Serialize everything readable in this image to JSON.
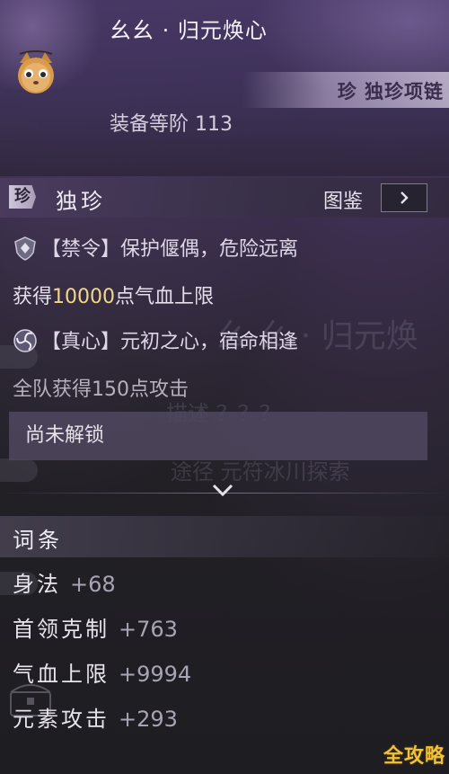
{
  "header": {
    "item_name": "幺幺 · 归元焕心",
    "item_type": "珍 独珍项链",
    "gear_level": "装备等阶 113"
  },
  "rarity_section": {
    "badge": "珍",
    "title": "独珍",
    "catalog_label": "图鉴"
  },
  "effects": {
    "forbidden_title": "【禁令】保护偃偶，危险远离",
    "forbidden_desc_prefix": "获得",
    "forbidden_desc_value": "10000",
    "forbidden_desc_suffix": "点气血上限",
    "truth_title": "【真心】元初之心，宿命相逢",
    "truth_desc": "全队获得150点攻击",
    "locked_text": "尚未解锁"
  },
  "stats_section": {
    "title": "词条",
    "rows": [
      {
        "name": "身法",
        "value": "+68"
      },
      {
        "name": "首领克制",
        "value": "+763"
      },
      {
        "name": "气血上限",
        "value": "+9994"
      },
      {
        "name": "元素攻击",
        "value": "+293"
      }
    ]
  },
  "watermark": "全攻略",
  "colors": {
    "highlight": "#f3d68a",
    "watermark": "#f0c23a",
    "accent_purple": "#4b3c5f"
  }
}
